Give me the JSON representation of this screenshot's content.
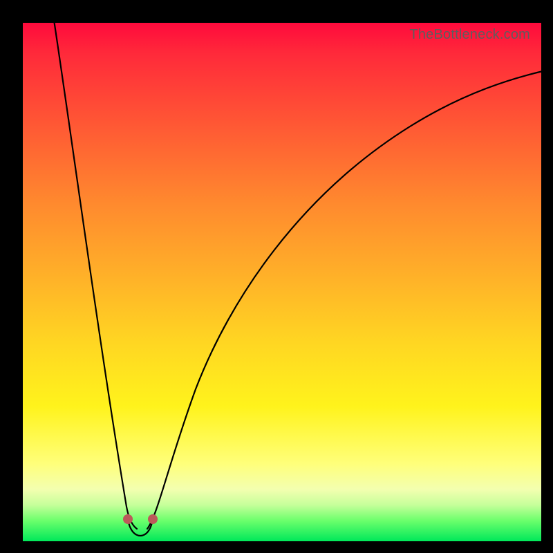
{
  "watermark": "TheBottleneck.com",
  "colors": {
    "frame": "#000000",
    "curve": "#000000",
    "marker": "#bb5a5a",
    "gradient_top": "#ff0a3c",
    "gradient_bottom": "#00e85a"
  },
  "chart_data": {
    "type": "line",
    "title": "",
    "xlabel": "",
    "ylabel": "",
    "xlim": [
      0,
      100
    ],
    "ylim": [
      0,
      100
    ],
    "grid": false,
    "legend": false,
    "annotations": [
      "TheBottleneck.com"
    ],
    "series": [
      {
        "name": "left-branch",
        "x": [
          6,
          8,
          10,
          12,
          14,
          16,
          18,
          19,
          20,
          21
        ],
        "y": [
          100,
          86,
          72,
          58,
          44,
          30,
          16,
          9,
          3,
          0
        ]
      },
      {
        "name": "right-branch",
        "x": [
          24,
          26,
          28,
          31,
          35,
          40,
          46,
          53,
          61,
          70,
          80,
          90,
          100
        ],
        "y": [
          0,
          7,
          14,
          23,
          33,
          43,
          52,
          60,
          67,
          73,
          79,
          84,
          88
        ]
      }
    ],
    "markers": [
      {
        "name": "min-left-dot",
        "x": 20,
        "y": 2
      },
      {
        "name": "min-right-dot",
        "x": 24,
        "y": 2
      },
      {
        "name": "min-bowl",
        "x": 22,
        "y": 0
      }
    ]
  }
}
